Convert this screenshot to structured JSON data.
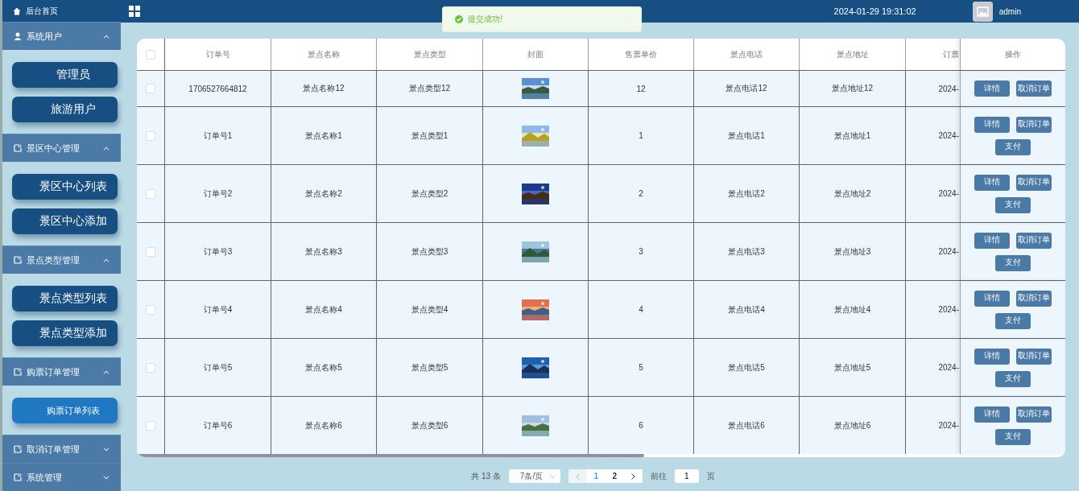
{
  "sidebar": {
    "home": "后台首页",
    "groups": [
      {
        "label": "系统用户",
        "expanded": true,
        "items": [
          {
            "label": "管理员",
            "selected": false
          },
          {
            "label": "旅游用户",
            "selected": false
          }
        ]
      },
      {
        "label": "景区中心管理",
        "expanded": true,
        "items": [
          {
            "label": "景区中心列表",
            "selected": false
          },
          {
            "label": "景区中心添加",
            "selected": false
          }
        ]
      },
      {
        "label": "景点类型管理",
        "expanded": true,
        "items": [
          {
            "label": "景点类型列表",
            "selected": false
          },
          {
            "label": "景点类型添加",
            "selected": false
          }
        ]
      },
      {
        "label": "购票订单管理",
        "expanded": true,
        "items": [
          {
            "label": "购票订单列表",
            "selected": true
          }
        ]
      },
      {
        "label": "取消订单管理",
        "expanded": false
      },
      {
        "label": "系统管理",
        "expanded": false
      }
    ]
  },
  "header": {
    "datetime": "2024-01-29 19:31:02",
    "user": "admin"
  },
  "toast": {
    "message": "提交成功!"
  },
  "table": {
    "select_all_checked": false,
    "columns": [
      "订单号",
      "景点名称",
      "景点类型",
      "封面",
      "售票单价",
      "景点电话",
      "景点地址",
      "订票"
    ],
    "action_column": "操作",
    "rows": [
      {
        "checked": false,
        "order": "1706527664812",
        "name": "景点名称12",
        "type": "景点类型12",
        "cover": {
          "kind": "picture"
        },
        "price": "12",
        "phone": "景点电话12",
        "address": "景点地址12",
        "date": "2024-",
        "actions": [
          "详情",
          "取消订单"
        ]
      },
      {
        "checked": false,
        "order": "订单号1",
        "name": "景点名称1",
        "type": "景点类型1",
        "cover": {
          "kind": "picture"
        },
        "price": "1",
        "phone": "景点电话1",
        "address": "景点地址1",
        "date": "2024-",
        "actions": [
          "详情",
          "取消订单",
          "支付"
        ]
      },
      {
        "checked": false,
        "order": "订单号2",
        "name": "景点名称2",
        "type": "景点类型2",
        "cover": {
          "kind": "picture"
        },
        "price": "2",
        "phone": "景点电话2",
        "address": "景点地址2",
        "date": "2024-",
        "actions": [
          "详情",
          "取消订单",
          "支付"
        ]
      },
      {
        "checked": false,
        "order": "订单号3",
        "name": "景点名称3",
        "type": "景点类型3",
        "cover": {
          "kind": "picture"
        },
        "price": "3",
        "phone": "景点电话3",
        "address": "景点地址3",
        "date": "2024-",
        "actions": [
          "详情",
          "取消订单",
          "支付"
        ]
      },
      {
        "checked": false,
        "order": "订单号4",
        "name": "景点名称4",
        "type": "景点类型4",
        "cover": {
          "kind": "picture"
        },
        "price": "4",
        "phone": "景点电话4",
        "address": "景点地址4",
        "date": "2024-",
        "actions": [
          "详情",
          "取消订单",
          "支付"
        ]
      },
      {
        "checked": false,
        "order": "订单号5",
        "name": "景点名称5",
        "type": "景点类型5",
        "cover": {
          "kind": "picture"
        },
        "price": "5",
        "phone": "景点电话5",
        "address": "景点地址5",
        "date": "2024-",
        "actions": [
          "详情",
          "取消订单",
          "支付"
        ]
      },
      {
        "checked": false,
        "order": "订单号6",
        "name": "景点名称6",
        "type": "景点类型6",
        "cover": {
          "kind": "picture"
        },
        "price": "6",
        "phone": "景点电话6",
        "address": "景点地址6",
        "date": "2024-",
        "actions": [
          "详情",
          "取消订单",
          "支付"
        ]
      }
    ]
  },
  "pagination": {
    "total": "共 13 条",
    "page_size": "7条/页",
    "pages": [
      {
        "label": "1",
        "selected": true
      },
      {
        "label": "2",
        "selected": false
      }
    ],
    "goto_label": "前往",
    "goto_value": "1",
    "goto_suffix": "页"
  }
}
